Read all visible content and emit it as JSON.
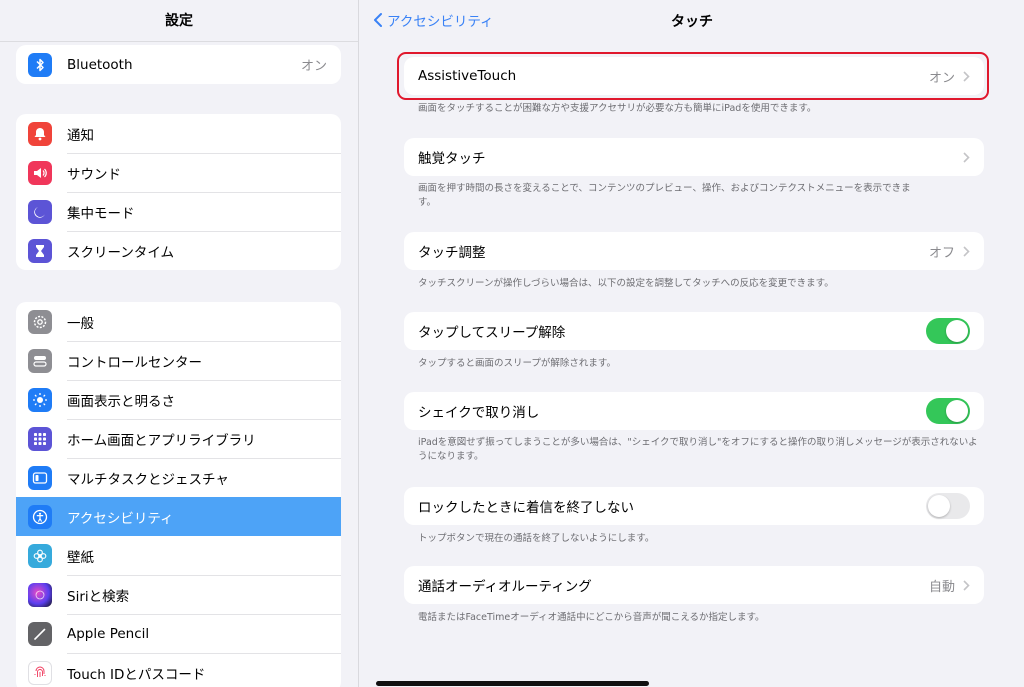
{
  "colors": {
    "accent": "#3a82f6",
    "selected_row": "#4da3f7",
    "toggle_on": "#34c759",
    "highlight": "#e0182d"
  },
  "sidebar": {
    "title": "設定",
    "bluetooth": {
      "label": "Bluetooth",
      "value": "オン",
      "icon": "bluetooth-icon",
      "color": "#1f7cf6"
    },
    "group2": [
      {
        "label": "通知",
        "icon": "bell-icon",
        "color": "#f0443a"
      },
      {
        "label": "サウンド",
        "icon": "speaker-icon",
        "color": "#f0365a"
      },
      {
        "label": "集中モード",
        "icon": "moon-icon",
        "color": "#5c54d6"
      },
      {
        "label": "スクリーンタイム",
        "icon": "hourglass-icon",
        "color": "#5c54d6"
      }
    ],
    "group3": [
      {
        "label": "一般",
        "icon": "gear-icon",
        "color": "#8e8e93"
      },
      {
        "label": "コントロールセンター",
        "icon": "switches-icon",
        "color": "#8e8e93"
      },
      {
        "label": "画面表示と明るさ",
        "icon": "sun-icon",
        "color": "#1f7cf6"
      },
      {
        "label": "ホーム画面とアプリライブラリ",
        "icon": "grid-icon",
        "color": "#5c54d6"
      },
      {
        "label": "マルチタスクとジェスチャ",
        "icon": "multitask-icon",
        "color": "#1f7cf6"
      },
      {
        "label": "アクセシビリティ",
        "icon": "accessibility-icon",
        "color": "#1f7cf6",
        "selected": true
      },
      {
        "label": "壁紙",
        "icon": "flower-icon",
        "color": "#36aadc"
      },
      {
        "label": "Siriと検索",
        "icon": "siri-icon",
        "color": "#222222"
      },
      {
        "label": "Apple Pencil",
        "icon": "pencil-icon",
        "color": "#636366"
      },
      {
        "label": "Touch IDとパスコード",
        "icon": "fingerprint-icon",
        "color": "#ffffff"
      }
    ]
  },
  "main": {
    "back_label": "アクセシビリティ",
    "title": "タッチ",
    "items": [
      {
        "label": "AssistiveTouch",
        "value": "オン",
        "desc": "画面をタッチすることが困難な方や支援アクセサリが必要な方も簡単にiPadを使用できます。"
      },
      {
        "label": "触覚タッチ",
        "value": "",
        "desc": "画面を押す時間の長さを変えることで、コンテンツのプレビュー、操作、およびコンテクストメニューを表示できます。"
      },
      {
        "label": "タッチ調整",
        "value": "オフ",
        "desc": "タッチスクリーンが操作しづらい場合は、以下の設定を調整してタッチへの反応を変更できます。"
      },
      {
        "label": "タップしてスリープ解除",
        "toggle": true,
        "desc": "タップすると画面のスリープが解除されます。"
      },
      {
        "label": "シェイクで取り消し",
        "toggle": true,
        "desc": "iPadを意図せず振ってしまうことが多い場合は、\"シェイクで取り消し\"をオフにすると操作の取り消しメッセージが表示されないようになります。"
      },
      {
        "label": "ロックしたときに着信を終了しない",
        "toggle": false,
        "desc": "トップボタンで現在の通話を終了しないようにします。"
      },
      {
        "label": "通話オーディオルーティング",
        "value": "自動",
        "desc": "電話またはFaceTimeオーディオ通話中にどこから音声が聞こえるか指定します。"
      }
    ]
  }
}
